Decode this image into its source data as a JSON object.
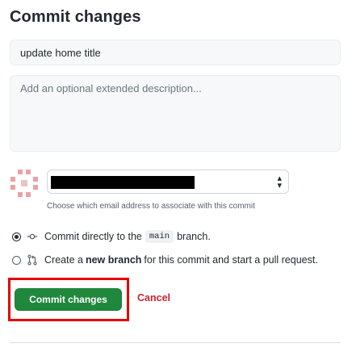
{
  "header": {
    "title": "Commit changes"
  },
  "summary": {
    "value": "update home title"
  },
  "description": {
    "placeholder": "Add an optional extended description..."
  },
  "author": {
    "email_help": "Choose which email address to associate with this commit",
    "select_arrow_icon": "select-arrows-icon"
  },
  "options": {
    "direct": {
      "selected": true,
      "icon": "git-commit-icon",
      "text_before": "Commit directly to the",
      "branch": "main",
      "text_after": "branch."
    },
    "new_branch": {
      "selected": false,
      "icon": "git-pull-request-icon",
      "text_before": "Create a",
      "bold": "new branch",
      "text_after": "for this commit and start a pull request."
    }
  },
  "actions": {
    "commit_label": "Commit changes",
    "cancel_label": "Cancel"
  },
  "colors": {
    "primary": "#1f883d",
    "danger": "#cf222e",
    "highlight": "#e60000",
    "avatar": "#e8a3a3"
  }
}
